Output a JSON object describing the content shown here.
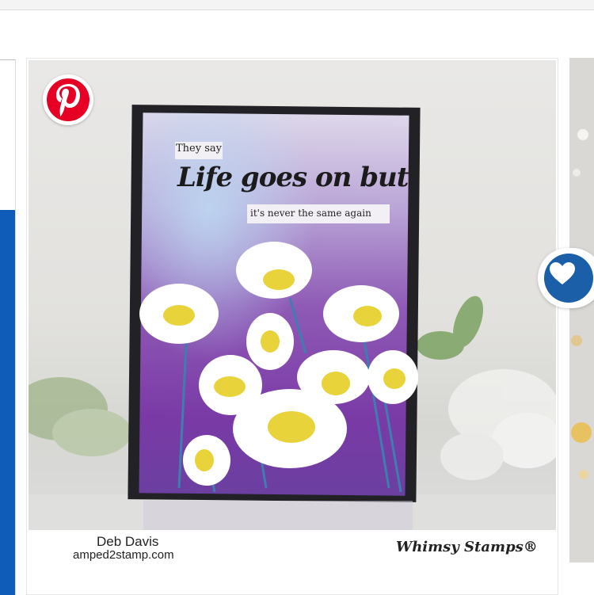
{
  "card": {
    "card_text": {
      "line1": "They say",
      "line2": "Life goes on but",
      "line3": "it's never the same again"
    },
    "credit_name": "Deb Davis",
    "credit_site": "amped2stamp.com",
    "brand": "Whimsy Stamps®"
  },
  "buttons": {
    "pin_icon": "pinterest-icon",
    "fav_icon": "heart-icon"
  },
  "colors": {
    "pinterest_red": "#e60023",
    "favorite_blue": "#1b5fa9",
    "left_panel_blue": "#0e5bb8"
  }
}
